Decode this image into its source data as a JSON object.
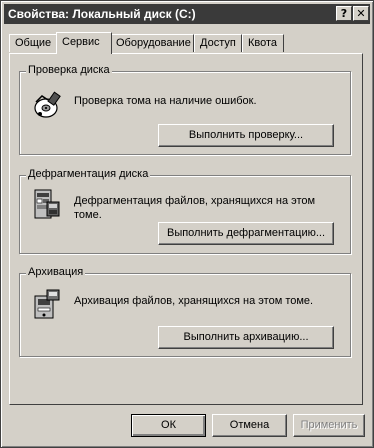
{
  "window": {
    "title": "Свойства: Локальный диск (C:)",
    "help_glyph": "?",
    "close_glyph": "✕"
  },
  "tabs": [
    {
      "label": "Общие",
      "active": false
    },
    {
      "label": "Сервис",
      "active": true
    },
    {
      "label": "Оборудование",
      "active": false
    },
    {
      "label": "Доступ",
      "active": false
    },
    {
      "label": "Квота",
      "active": false
    }
  ],
  "groups": {
    "check": {
      "title": "Проверка диска",
      "description": "Проверка тома на наличие ошибок.",
      "button": "Выполнить проверку...",
      "icon": "disk-check-icon"
    },
    "defrag": {
      "title": "Дефрагментация диска",
      "description": "Дефрагментация файлов, хранящихся на этом томе.",
      "button": "Выполнить дефрагментацию...",
      "icon": "defrag-icon"
    },
    "backup": {
      "title": "Архивация",
      "description": "Архивация файлов, хранящихся на этом томе.",
      "button": "Выполнить архивацию...",
      "icon": "backup-icon"
    }
  },
  "footer": {
    "ok": "ОК",
    "cancel": "Отмена",
    "apply": "Применить"
  }
}
